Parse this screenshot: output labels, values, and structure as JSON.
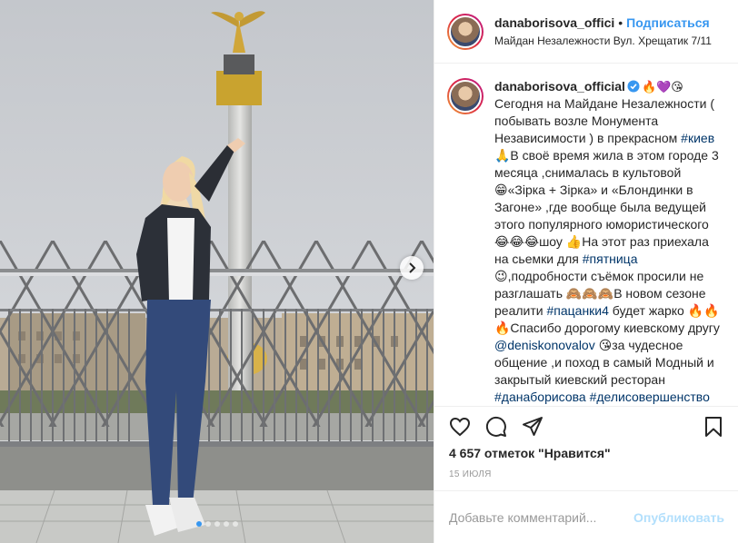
{
  "post": {
    "username": "danaborisova_offici",
    "separator": "•",
    "follow_label": "Подписаться",
    "location": "Майдан Незалежности Вул. Хрещатик 7/11"
  },
  "caption": {
    "username": "danaborisova_official",
    "head_emoji": "🔥💜😘",
    "t1": "Сегодня на Майдане Незалежности ( побывать возле Монумента Независимости ) в прекрасном ",
    "tag1": "#киев",
    "t2": " 🙏В своё время жила в этом городе 3 месяца ,снималась в культовой 😁«Зірка + Зірка» и «Блондинки в Загоне» ,где вообще была ведущей этого популярного юмористического 😂😂😂шоу 👍На этот раз приехала на сьемки для ",
    "tag2": "#пятница",
    "t3": "😉,подробности съёмок просили не разглашать 🙈🙈🙈В новом сезоне реалити ",
    "tag3": "#пацанки4",
    "t4": " будет жарко 🔥🔥🔥Спасибо дорогому киевскому другу ",
    "mention": "@deniskonovalov",
    "t5": " 😘за чудесное общение ,и поход в самый Модный и закрытый киевский ресторан ",
    "tag4": "#данаборисова",
    "tag5": "#делисовершенство"
  },
  "stats": {
    "likes": "4 657 отметок \"Нравится\"",
    "date": "15 ИЮЛЯ"
  },
  "comment": {
    "placeholder": "Добавьте комментарий...",
    "publish_label": "Опубликовать"
  },
  "carousel": {
    "slides": 5,
    "active_index": 0
  },
  "colors": {
    "accent": "#3897f0",
    "hashtag": "#003569",
    "publish_disabled": "#b2dffc",
    "heart": "#262626"
  },
  "icons": [
    "heart-icon",
    "comment-icon",
    "share-icon",
    "bookmark-icon",
    "verified-icon",
    "chevron-right-icon"
  ]
}
